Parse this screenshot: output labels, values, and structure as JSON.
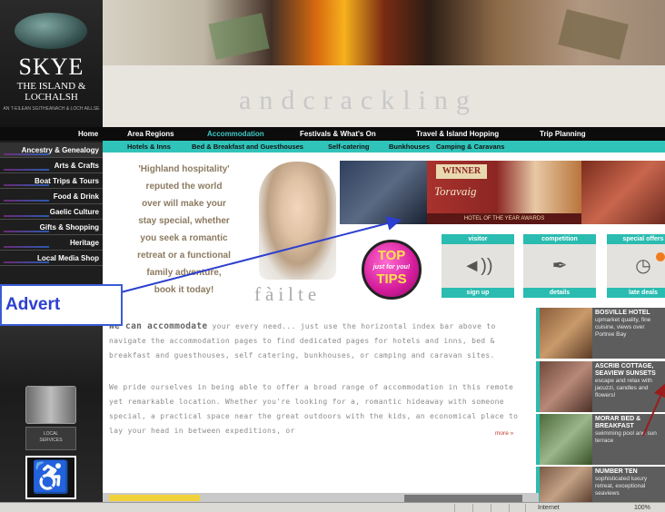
{
  "logo": {
    "title": "SKYE",
    "subtitle_line1": "THE ISLAND &",
    "subtitle_line2": "LOCHALSH",
    "gaelic": "AN T-EILEAN SGITHEANACH & LOCH AILLSE"
  },
  "header": {
    "tagline": "andcrackling"
  },
  "nav_main": [
    {
      "label": "Home",
      "active": false
    },
    {
      "label": "Area Regions",
      "active": false
    },
    {
      "label": "Accommodation",
      "active": true
    },
    {
      "label": "Festivals & What's On",
      "active": false
    },
    {
      "label": "Travel & Island Hopping",
      "active": false
    },
    {
      "label": "Trip Planning",
      "active": false
    }
  ],
  "nav_sub": [
    {
      "label": "Hotels & Inns"
    },
    {
      "label": "Bed & Breakfast and Guesthouses"
    },
    {
      "label": "Self-catering"
    },
    {
      "label": "Bunkhouses"
    },
    {
      "label": "Camping & Caravans"
    }
  ],
  "side_menu": [
    {
      "label": "Ancestry & Genealogy"
    },
    {
      "label": "Arts & Crafts"
    },
    {
      "label": "Boat Trips & Tours"
    },
    {
      "label": "Food & Drink"
    },
    {
      "label": "Gaelic Culture"
    },
    {
      "label": "Gifts & Shopping"
    },
    {
      "label": "Heritage"
    },
    {
      "label": "Local Media Shop"
    }
  ],
  "intro": {
    "line1": "'Highland hospitality'",
    "line2": "reputed the world",
    "line3": "over will make your",
    "line4": "stay special, whether",
    "line5": "you seek a romantic",
    "line6": "retreat or a functional",
    "line7": "family adventure,",
    "line8": "book it today!"
  },
  "failte": "fàilte",
  "adverts": {
    "winner": "WINNER",
    "hotel_name": "Toravaig",
    "award": "HOTEL OF THE YEAR AWARDS"
  },
  "tips": {
    "top": "TOP",
    "sub": "just for you!",
    "big": "TIPS"
  },
  "tiles": [
    {
      "top": "visitor",
      "bottom": "sign up",
      "icon": "speaker-icon",
      "glyph": "◄))"
    },
    {
      "top": "competition",
      "bottom": "details",
      "icon": "pen-icon",
      "glyph": "✒"
    },
    {
      "top": "special offers",
      "bottom": "late deals",
      "icon": "clock-icon",
      "glyph": "◷"
    }
  ],
  "body": {
    "p1_strong": "We can accommodate",
    "p1": " your every need... just use the horizontal index bar above to navigate the accommodation pages to find dedicated pages for hotels and inns, bed & breakfast and guesthouses, self catering, bunkhouses, or camping and caravan sites.",
    "p2": "We pride ourselves in being able to offer a broad range of accommodation in this remote yet remarkable location. Whether you're looking for a, romantic hideaway with someone special, a practical space near the great outdoors with the kids, an economical place to lay your head in between expeditions, or",
    "more": "more »"
  },
  "listings": [
    {
      "title": "BOSVILLE HOTEL",
      "desc": "upmarket quality, fine cuisine, views over Portree Bay"
    },
    {
      "title": "ASCRIB COTTAGE, SEAVIEW SUNSETS",
      "desc": "escape and relax with jacuzzi, candles and flowers!"
    },
    {
      "title": "MORAR BED & BREAKFAST",
      "desc": "swimming pool and sun terrace"
    },
    {
      "title": "NUMBER TEN",
      "desc": "sophisticated luxury retreat, exceptional seaviews"
    }
  ],
  "status_bar": {
    "zone": "Internet",
    "zoom": "100%"
  },
  "annotation": {
    "label": "Advert"
  },
  "colors": {
    "accent_teal": "#30c3b9",
    "nav_active": "#3ec8c5",
    "annotation_blue": "#2c3fd0",
    "intro_text": "#8c7a60"
  }
}
